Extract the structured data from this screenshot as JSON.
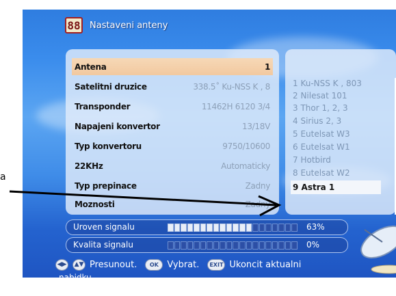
{
  "header": {
    "logo_text": "88",
    "title": "Nastaveni anteny"
  },
  "settings": [
    {
      "label": "Antena",
      "value": "1"
    },
    {
      "label": "Satelitni druzice",
      "value": "338.5˚ Ku-NSS K , 8"
    },
    {
      "label": "Transponder",
      "value": "11462H 6120 3/4"
    },
    {
      "label": "Napajeni konvertor",
      "value": "13/18V"
    },
    {
      "label": "Typ konvertoru",
      "value": "9750/10600"
    },
    {
      "label": "22KHz",
      "value": "Automaticky"
    },
    {
      "label": "Typ prepinace",
      "value": "Zadny"
    },
    {
      "label": "Moznosti",
      "value": "Zadny"
    }
  ],
  "satellites": [
    "1 Ku-NSS K , 803",
    "2 Nilesat 101",
    "3 Thor 1, 2, 3",
    "4 Sirius 2, 3",
    "5 Eutelsat W3",
    "6 Eutelsat W1",
    "7 Hotbird",
    "8 Eutelsat W2",
    "9 Astra 1"
  ],
  "signal": {
    "level_label": "Uroven signalu",
    "level_percent": "63%",
    "level_value": 0.63,
    "quality_label": "Kvalita signalu",
    "quality_percent": "0%",
    "quality_value": 0
  },
  "footer": {
    "move_label": "Presunout.",
    "ok_key": "OK",
    "select_label": "Vybrat.",
    "exit_key": "EXIT",
    "exit_label": "Ukoncit aktualni",
    "continuation": "nabidku"
  },
  "annotation": {
    "side_letter": "a"
  },
  "colors": {
    "selection": "#f2c9a0",
    "screen_blue": "#3a8cec",
    "arrow": "#000000"
  }
}
